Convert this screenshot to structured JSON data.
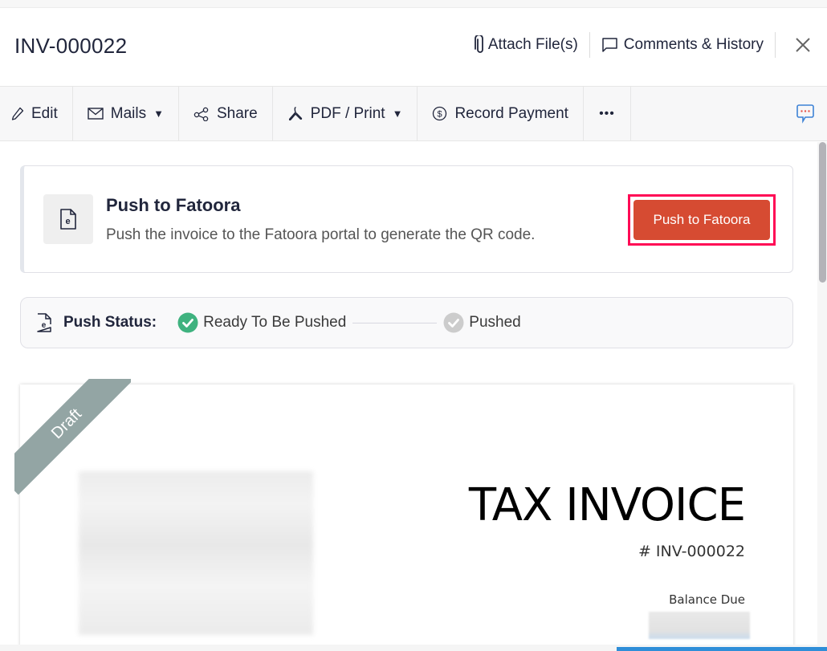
{
  "header": {
    "title": "INV-000022",
    "attach_label": "Attach File(s)",
    "comments_label": "Comments & History"
  },
  "toolbar": {
    "edit_label": "Edit",
    "mails_label": "Mails",
    "share_label": "Share",
    "pdf_label": "PDF / Print",
    "record_payment_label": "Record Payment",
    "more_label": "•••"
  },
  "push_card": {
    "title": "Push to Fatoora",
    "description": "Push the invoice to the Fatoora portal to generate the QR code.",
    "button_label": "Push to Fatoora"
  },
  "push_status": {
    "label": "Push Status:",
    "steps": [
      {
        "label": "Ready To Be Pushed",
        "state": "complete",
        "color": "#3fb27f"
      },
      {
        "label": "Pushed",
        "state": "pending",
        "color": "#cccccc"
      }
    ]
  },
  "invoice": {
    "ribbon": "Draft",
    "title": "TAX INVOICE",
    "number": "# INV-000022",
    "balance_label": "Balance Due"
  },
  "colors": {
    "accent_button": "#d64b32",
    "highlight_outline": "#ff0a55",
    "ribbon": "#93a5a4",
    "progress_bar": "#2f8ed8"
  }
}
